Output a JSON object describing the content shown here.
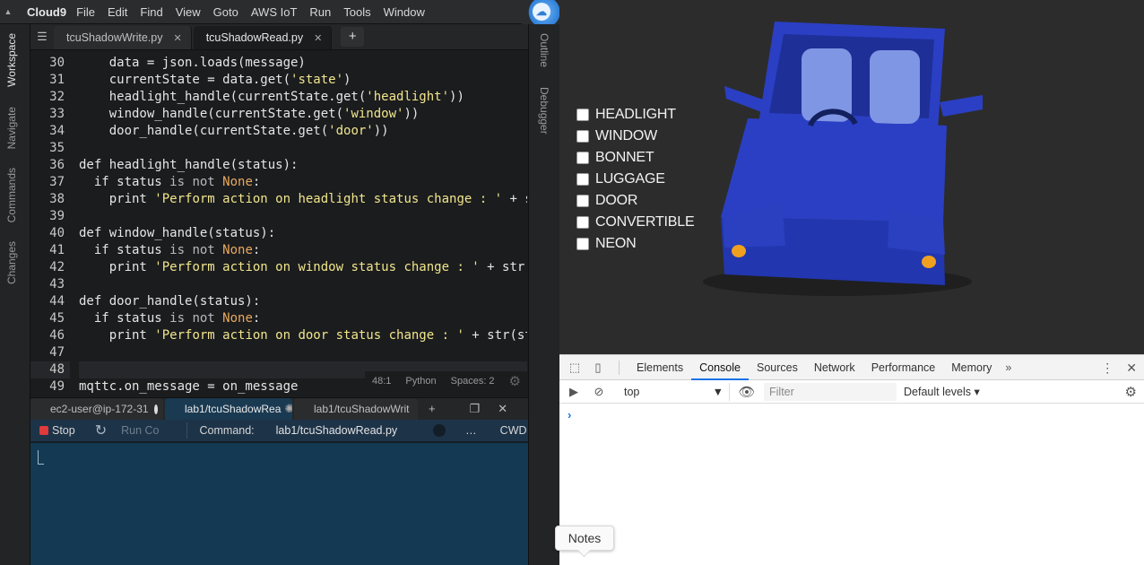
{
  "menubar": {
    "brand": "Cloud9",
    "menus": [
      "File",
      "Edit",
      "Find",
      "View",
      "Goto",
      "AWS IoT",
      "Run",
      "Tools",
      "Window"
    ]
  },
  "left_rail": [
    "Workspace",
    "Navigate",
    "Commands",
    "Changes"
  ],
  "right_rail": [
    "Outline",
    "Debugger"
  ],
  "editor_tabs": [
    {
      "label": "tcuShadowWrite.py",
      "active": false
    },
    {
      "label": "tcuShadowRead.py",
      "active": true
    }
  ],
  "code_lines": [
    {
      "n": "30",
      "html": "    data = json.loads(message)"
    },
    {
      "n": "31",
      "html": "    currentState = data.get(<span class=\"str\">'state'</span>)"
    },
    {
      "n": "32",
      "html": "    headlight_handle(currentState.get(<span class=\"str\">'headlight'</span>))"
    },
    {
      "n": "33",
      "html": "    window_handle(currentState.get(<span class=\"str\">'window'</span>))"
    },
    {
      "n": "34",
      "html": "    door_handle(currentState.get(<span class=\"str\">'door'</span>))"
    },
    {
      "n": "35",
      "html": ""
    },
    {
      "n": "36",
      "html": "def headlight_handle(status):"
    },
    {
      "n": "37",
      "html": "  if status <span class=\"kw2\">is not</span> <span class=\"none\">None</span>:"
    },
    {
      "n": "38",
      "html": "    print <span class=\"str\">'Perform action on headlight status change : '</span> + s"
    },
    {
      "n": "39",
      "html": ""
    },
    {
      "n": "40",
      "html": "def window_handle(status):"
    },
    {
      "n": "41",
      "html": "  if status <span class=\"kw2\">is not</span> <span class=\"none\">None</span>:"
    },
    {
      "n": "42",
      "html": "    print <span class=\"str\">'Perform action on window status change : '</span> + str("
    },
    {
      "n": "43",
      "html": ""
    },
    {
      "n": "44",
      "html": "def door_handle(status):"
    },
    {
      "n": "45",
      "html": "  if status <span class=\"kw2\">is not</span> <span class=\"none\">None</span>:"
    },
    {
      "n": "46",
      "html": "    print <span class=\"str\">'Perform action on door status change : '</span> + str(st"
    },
    {
      "n": "47",
      "html": ""
    },
    {
      "n": "48",
      "html": "",
      "active": true
    },
    {
      "n": "49",
      "html": "mqttc.on_message = on_message"
    }
  ],
  "status": {
    "position": "48:1",
    "language": "Python",
    "spaces": "Spaces: 2"
  },
  "terminal_tabs": [
    {
      "label": "ec2-user@ip-172-31",
      "active": false,
      "kind": "dot"
    },
    {
      "label": "lab1/tcuShadowRea",
      "active": true,
      "kind": "spin"
    },
    {
      "label": "lab1/tcuShadowWrit",
      "active": false,
      "kind": "x"
    }
  ],
  "term_toolbar": {
    "stop": "Stop",
    "run_config": "Run Co",
    "command_label": "Command:",
    "command_value": "lab1/tcuShadowRead.py",
    "ellipsis": "…",
    "cwd": "CWD"
  },
  "car_options": [
    "HEADLIGHT",
    "WINDOW",
    "BONNET",
    "LUGGAGE",
    "DOOR",
    "CONVERTIBLE",
    "NEON"
  ],
  "car_colors": {
    "body": "#2b3fc4",
    "light": "#f0a020"
  },
  "devtools": {
    "tabs": [
      "Elements",
      "Console",
      "Sources",
      "Network",
      "Performance",
      "Memory"
    ],
    "active_tab": "Console",
    "more": "»",
    "context": "top",
    "filter_placeholder": "Filter",
    "levels": "Default levels ▾",
    "prompt": "›"
  },
  "notes_label": "Notes"
}
